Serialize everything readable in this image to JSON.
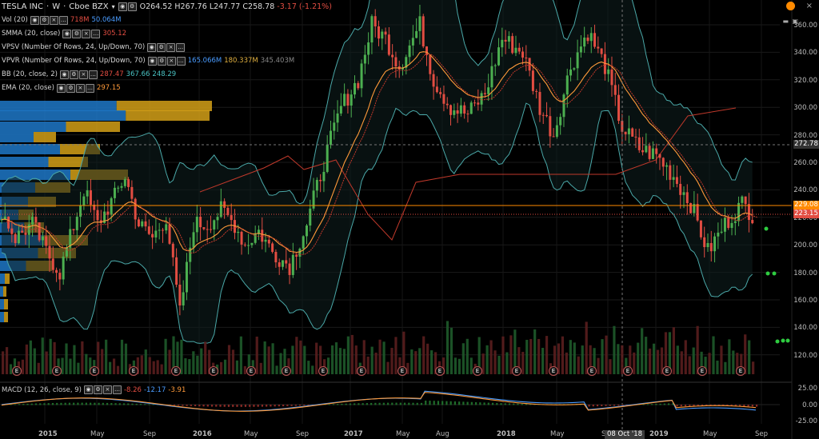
{
  "header": {
    "symbol": "TESLA INC",
    "interval": "W",
    "exchange": "Cboe BZX",
    "open": "O264.52",
    "high": "H267.76",
    "low": "L247.77",
    "close": "C258.78",
    "change": "-3.17 (-1.21%)"
  },
  "indicators": [
    {
      "name": "Vol (20)",
      "values": [
        {
          "t": "718M",
          "c": "#e24d42"
        },
        {
          "t": "50.064M",
          "c": "#4a9cff"
        }
      ]
    },
    {
      "name": "SMMA (20, close)",
      "values": [
        {
          "t": "305.12",
          "c": "#e24d42"
        }
      ]
    },
    {
      "name": "VPSV (Number Of Rows, 24, Up/Down, 70)",
      "values": []
    },
    {
      "name": "VPVR (Number Of Rows, 24, Up/Down, 70)",
      "values": [
        {
          "t": "165.066M",
          "c": "#4a9cff"
        },
        {
          "t": "180.337M",
          "c": "#e0b040"
        },
        {
          "t": "345.403M",
          "c": "#888"
        }
      ]
    },
    {
      "name": "BB (20, close, 2)",
      "values": [
        {
          "t": "287.47",
          "c": "#e24d42"
        },
        {
          "t": "367.66",
          "c": "#4ac3c3"
        },
        {
          "t": "248.29",
          "c": "#4ac3c3"
        }
      ]
    },
    {
      "name": "EMA (20, close)",
      "values": [
        {
          "t": "297.15",
          "c": "#ff9a3a"
        }
      ]
    }
  ],
  "macd": {
    "name": "MACD (12, 26, close, 9)",
    "values": [
      {
        "t": "-8.26",
        "c": "#e24d42"
      },
      {
        "t": "-12.17",
        "c": "#4a9cff"
      },
      {
        "t": "-3.91",
        "c": "#ff9a3a"
      }
    ]
  },
  "price_axis": [
    "360.00",
    "340.00",
    "320.00",
    "300.00",
    "280.00",
    "260.00",
    "240.00",
    "220.00",
    "200.00",
    "180.00",
    "160.00",
    "140.00",
    "120.00"
  ],
  "macd_axis": [
    "25.00",
    "0.00",
    "-25.00"
  ],
  "price_tags": {
    "crosshair": "272.78",
    "last": "229.08",
    "close": "223.15"
  },
  "time_axis": [
    "2015",
    "May",
    "Sep",
    "2016",
    "May",
    "Sep",
    "2017",
    "May",
    "Aug",
    "2018",
    "May",
    "Sep",
    "2019",
    "May",
    "Sep"
  ],
  "crosshair_date": "08 Oct '18",
  "earnings_label": "E",
  "colors": {
    "up": "#4caf50",
    "down": "#e24d42",
    "bb": "#4aa8a8",
    "ema": "#ff9a3a",
    "smma": "#c0392b",
    "vpvr_blue": "#1e78c8",
    "vpvr_yellow": "#d4a017"
  }
}
